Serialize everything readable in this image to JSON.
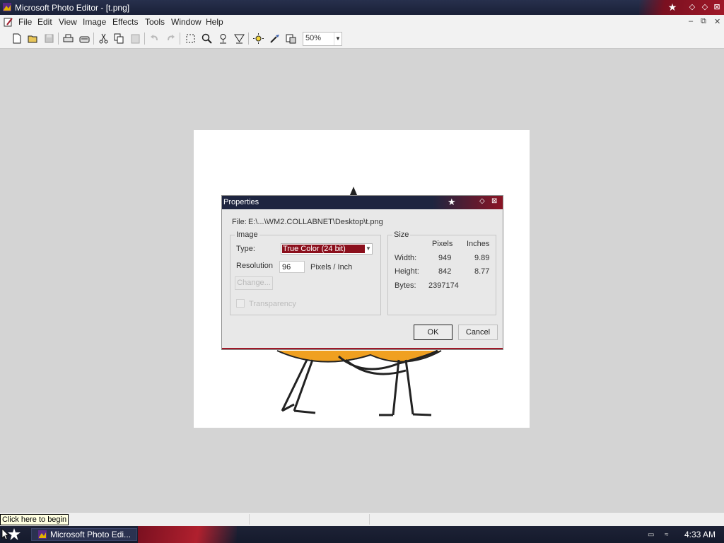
{
  "window": {
    "title": "Microsoft Photo Editor - [t.png]"
  },
  "menubar": {
    "items": [
      "File",
      "Edit",
      "View",
      "Image",
      "Effects",
      "Tools",
      "Window",
      "Help"
    ]
  },
  "toolbar": {
    "zoom_value": "50%",
    "buttons": [
      "new-icon",
      "open-icon",
      "save-icon",
      "print-icon",
      "scan-icon",
      "cut-icon",
      "copy-icon",
      "paste-icon",
      "undo-icon",
      "redo-icon",
      "select-icon",
      "zoom-icon",
      "smudge-icon",
      "sharpen-icon",
      "brightness-icon",
      "eyedropper-icon",
      "properties-icon"
    ]
  },
  "dialog": {
    "title": "Properties",
    "file_label": "File:",
    "file_path": "E:\\...\\WM2.COLLABNET\\Desktop\\t.png",
    "image_group": "Image",
    "type_label": "Type:",
    "type_value": "True Color (24 bit)",
    "resolution_label": "Resolution",
    "resolution_value": "96",
    "resolution_unit": "Pixels / Inch",
    "change_button": "Change...",
    "transparency_label": "Transparency",
    "size_group": "Size",
    "col_pixels": "Pixels",
    "col_inches": "Inches",
    "width_label": "Width:",
    "width_pixels": "949",
    "width_inches": "9.89",
    "height_label": "Height:",
    "height_pixels": "842",
    "height_inches": "8.77",
    "bytes_label": "Bytes:",
    "bytes_value": "2397174",
    "ok_button": "OK",
    "cancel_button": "Cancel"
  },
  "status": {
    "tooltip": "Click here to begin"
  },
  "taskbar": {
    "task_label": "Microsoft Photo Edi...",
    "clock": "4:33 AM"
  },
  "colors": {
    "title_dark": "#1e2540",
    "accent_red": "#8b0f1c"
  }
}
